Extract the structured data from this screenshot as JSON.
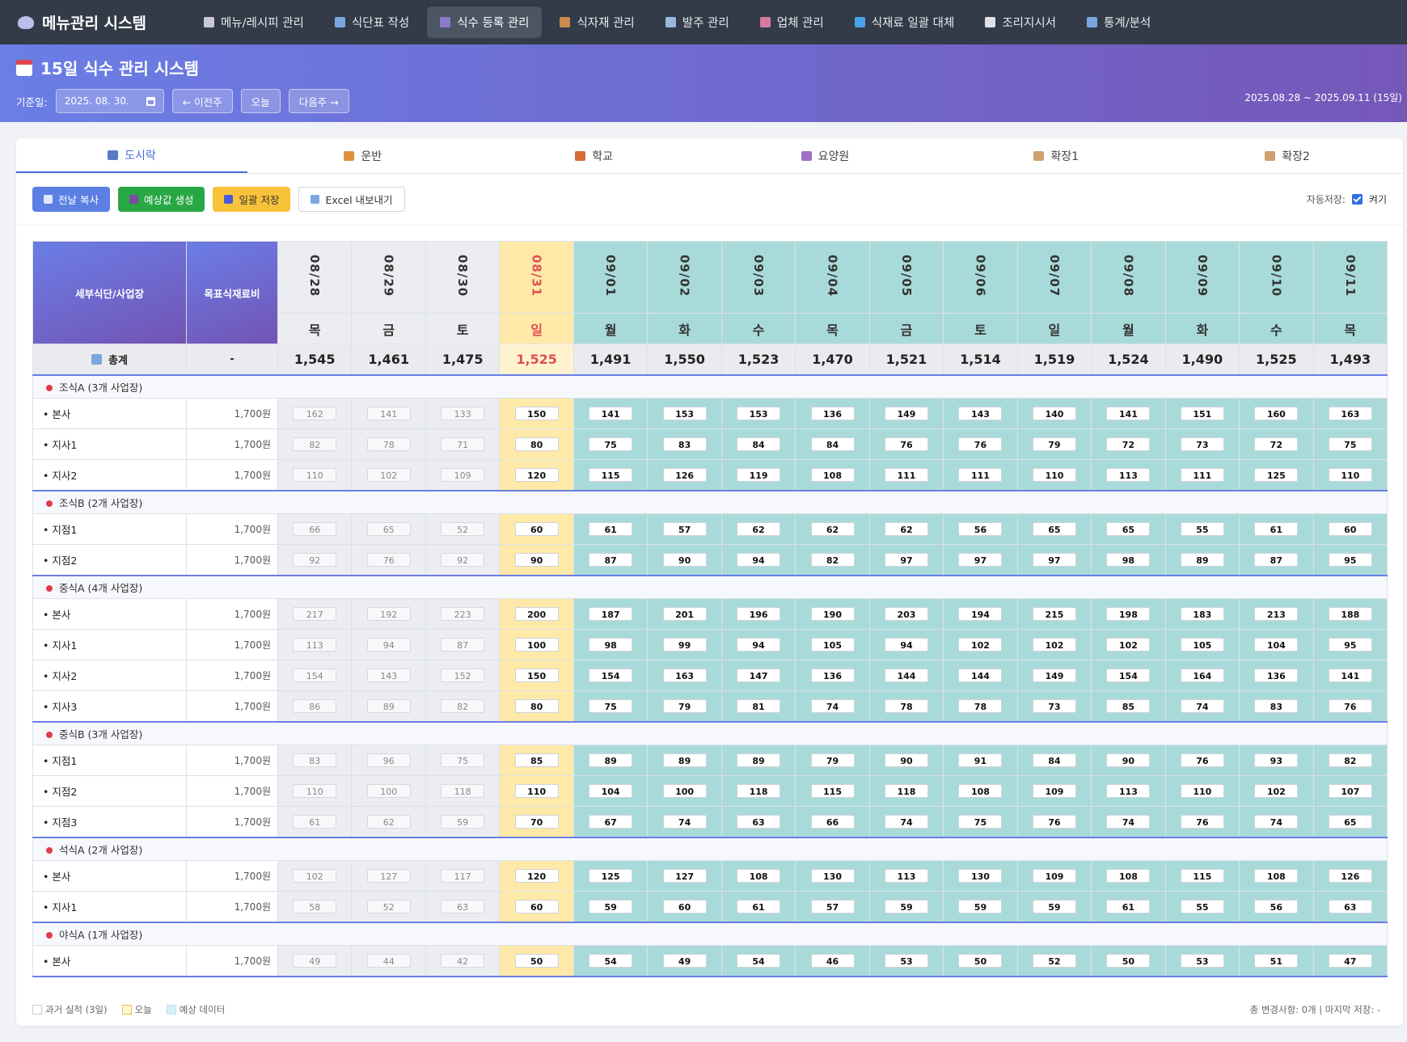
{
  "app": {
    "title": "메뉴관리 시스템"
  },
  "nav": [
    {
      "label": "메뉴/레시피 관리",
      "icon": "clipboard-icon",
      "color": "#c8c8d8"
    },
    {
      "label": "식단표 작성",
      "icon": "bar-chart-icon",
      "color": "#7aa7e0"
    },
    {
      "label": "식수 등록 관리",
      "icon": "people-icon",
      "color": "#8e7ac8",
      "active": true
    },
    {
      "label": "식자재 관리",
      "icon": "box-icon",
      "color": "#c98a4b"
    },
    {
      "label": "발주 관리",
      "icon": "trend-chart-icon",
      "color": "#9bb6df"
    },
    {
      "label": "업체 관리",
      "icon": "store-icon",
      "color": "#d57aa0"
    },
    {
      "label": "식재료 일괄 대체",
      "icon": "refresh-icon",
      "color": "#4aa3e8"
    },
    {
      "label": "조리지시서",
      "icon": "clipboard-icon",
      "color": "#e0e0e8"
    },
    {
      "label": "통계/분석",
      "icon": "bar-chart-icon",
      "color": "#7aa7e0"
    }
  ],
  "header": {
    "title": "15일 식수 관리 시스템",
    "date_label": "기준일:",
    "date_value": "2025. 08. 30.",
    "prev_label": "← 이전주",
    "today_label": "오늘",
    "next_label": "다음주 →",
    "range": "2025.08.28 ~ 2025.09.11 (15일)"
  },
  "tabs": [
    {
      "label": "도시락",
      "color": "#5a7ac8",
      "active": true
    },
    {
      "label": "운반",
      "color": "#e0903a"
    },
    {
      "label": "학교",
      "color": "#d46b3a"
    },
    {
      "label": "요양원",
      "color": "#a06fc8"
    },
    {
      "label": "확장1",
      "color": "#d0a070"
    },
    {
      "label": "확장2",
      "color": "#d0a070"
    }
  ],
  "toolbar": {
    "copy_label": "전날 복사",
    "forecast_label": "예상값 생성",
    "save_label": "일괄 저장",
    "excel_label": "Excel 내보내기",
    "autosave_label": "자동저장:",
    "autosave_state": "켜기"
  },
  "table": {
    "col_name": "세부식단/사업장",
    "col_cost": "목표식재료비",
    "dates": [
      {
        "date": "08/28",
        "dow": "목",
        "type": "past"
      },
      {
        "date": "08/29",
        "dow": "금",
        "type": "past"
      },
      {
        "date": "08/30",
        "dow": "토",
        "type": "past"
      },
      {
        "date": "08/31",
        "dow": "일",
        "type": "today"
      },
      {
        "date": "09/01",
        "dow": "월",
        "type": "future"
      },
      {
        "date": "09/02",
        "dow": "화",
        "type": "future"
      },
      {
        "date": "09/03",
        "dow": "수",
        "type": "future"
      },
      {
        "date": "09/04",
        "dow": "목",
        "type": "future"
      },
      {
        "date": "09/05",
        "dow": "금",
        "type": "future"
      },
      {
        "date": "09/06",
        "dow": "토",
        "type": "future"
      },
      {
        "date": "09/07",
        "dow": "일",
        "type": "future"
      },
      {
        "date": "09/08",
        "dow": "월",
        "type": "future"
      },
      {
        "date": "09/09",
        "dow": "화",
        "type": "future"
      },
      {
        "date": "09/10",
        "dow": "수",
        "type": "future"
      },
      {
        "date": "09/11",
        "dow": "목",
        "type": "future"
      }
    ],
    "total": {
      "label": "총계",
      "cost": "-",
      "values": [
        "1,545",
        "1,461",
        "1,475",
        "1,525",
        "1,491",
        "1,550",
        "1,523",
        "1,470",
        "1,521",
        "1,514",
        "1,519",
        "1,524",
        "1,490",
        "1,525",
        "1,493"
      ]
    },
    "groups": [
      {
        "label": "조식A (3개 사업장)",
        "rows": [
          {
            "name": "• 본사",
            "cost": "1,700원",
            "values": [
              162,
              141,
              133,
              150,
              141,
              153,
              153,
              136,
              149,
              143,
              140,
              141,
              151,
              160,
              163
            ]
          },
          {
            "name": "• 지사1",
            "cost": "1,700원",
            "values": [
              82,
              78,
              71,
              80,
              75,
              83,
              84,
              84,
              76,
              76,
              79,
              72,
              73,
              72,
              75
            ]
          },
          {
            "name": "• 지사2",
            "cost": "1,700원",
            "values": [
              110,
              102,
              109,
              120,
              115,
              126,
              119,
              108,
              111,
              111,
              110,
              113,
              111,
              125,
              110
            ]
          }
        ]
      },
      {
        "label": "조식B (2개 사업장)",
        "rows": [
          {
            "name": "• 지점1",
            "cost": "1,700원",
            "values": [
              66,
              65,
              52,
              60,
              61,
              57,
              62,
              62,
              62,
              56,
              65,
              65,
              55,
              61,
              60
            ]
          },
          {
            "name": "• 지점2",
            "cost": "1,700원",
            "values": [
              92,
              76,
              92,
              90,
              87,
              90,
              94,
              82,
              97,
              97,
              97,
              98,
              89,
              87,
              95
            ]
          }
        ]
      },
      {
        "label": "중식A (4개 사업장)",
        "rows": [
          {
            "name": "• 본사",
            "cost": "1,700원",
            "values": [
              217,
              192,
              223,
              200,
              187,
              201,
              196,
              190,
              203,
              194,
              215,
              198,
              183,
              213,
              188
            ]
          },
          {
            "name": "• 지사1",
            "cost": "1,700원",
            "values": [
              113,
              94,
              87,
              100,
              98,
              99,
              94,
              105,
              94,
              102,
              102,
              102,
              105,
              104,
              95
            ]
          },
          {
            "name": "• 지사2",
            "cost": "1,700원",
            "values": [
              154,
              143,
              152,
              150,
              154,
              163,
              147,
              136,
              144,
              144,
              149,
              154,
              164,
              136,
              141
            ]
          },
          {
            "name": "• 지사3",
            "cost": "1,700원",
            "values": [
              86,
              89,
              82,
              80,
              75,
              79,
              81,
              74,
              78,
              78,
              73,
              85,
              74,
              83,
              76
            ]
          }
        ]
      },
      {
        "label": "중식B (3개 사업장)",
        "rows": [
          {
            "name": "• 지점1",
            "cost": "1,700원",
            "values": [
              83,
              96,
              75,
              85,
              89,
              89,
              89,
              79,
              90,
              91,
              84,
              90,
              76,
              93,
              82
            ]
          },
          {
            "name": "• 지점2",
            "cost": "1,700원",
            "values": [
              110,
              100,
              118,
              110,
              104,
              100,
              118,
              115,
              118,
              108,
              109,
              113,
              110,
              102,
              107
            ]
          },
          {
            "name": "• 지점3",
            "cost": "1,700원",
            "values": [
              61,
              62,
              59,
              70,
              67,
              74,
              63,
              66,
              74,
              75,
              76,
              74,
              76,
              74,
              65
            ]
          }
        ]
      },
      {
        "label": "석식A (2개 사업장)",
        "rows": [
          {
            "name": "• 본사",
            "cost": "1,700원",
            "values": [
              102,
              127,
              117,
              120,
              125,
              127,
              108,
              130,
              113,
              130,
              109,
              108,
              115,
              108,
              126
            ]
          },
          {
            "name": "• 지사1",
            "cost": "1,700원",
            "values": [
              58,
              52,
              63,
              60,
              59,
              60,
              61,
              57,
              59,
              59,
              59,
              61,
              55,
              56,
              63
            ]
          }
        ]
      },
      {
        "label": "야식A (1개 사업장)",
        "rows": [
          {
            "name": "• 본사",
            "cost": "1,700원",
            "values": [
              49,
              44,
              42,
              50,
              54,
              49,
              54,
              46,
              53,
              50,
              52,
              50,
              53,
              51,
              47
            ]
          }
        ]
      }
    ]
  },
  "legend": {
    "past": "과거 실적 (3일)",
    "today": "오늘",
    "future": "예상 데이터",
    "status": "총 변경사항: 0개 | 마지막 저장: -"
  }
}
